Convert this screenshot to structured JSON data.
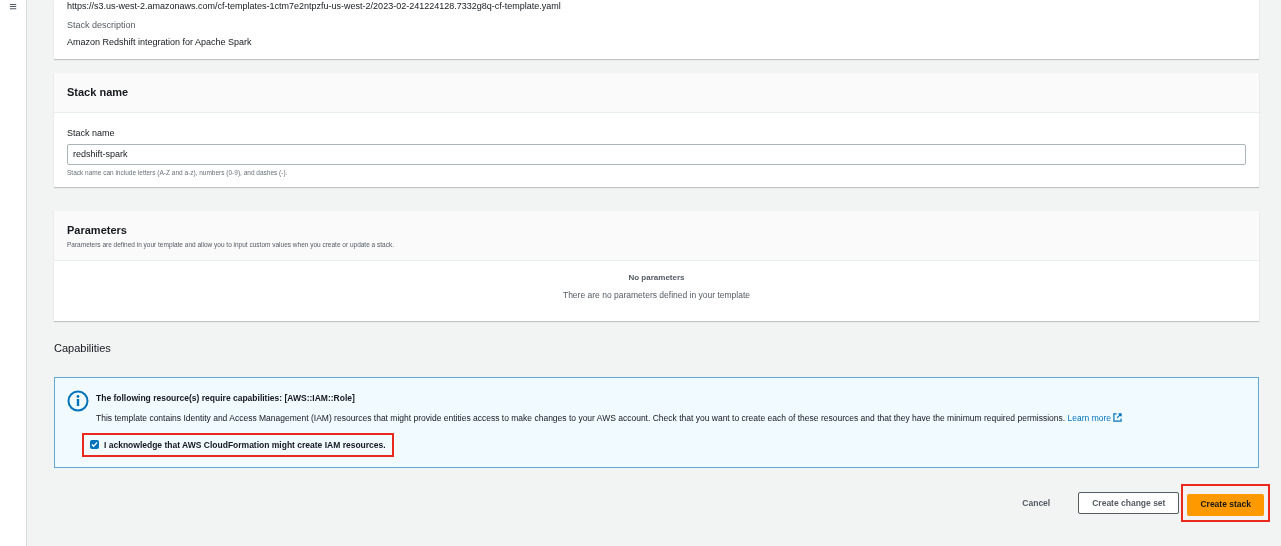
{
  "menu_icon": "≡",
  "template_card": {
    "url": "https://s3.us-west-2.amazonaws.com/cf-templates-1ctm7e2ntpzfu-us-west-2/2023-02-241224128.7332g8q-cf-template.yaml",
    "description_label": "Stack description",
    "description": "Amazon Redshift integration for Apache Spark"
  },
  "stack_name_card": {
    "title": "Stack name",
    "field_label": "Stack name",
    "value": "redshift-spark",
    "hint": "Stack name can include letters (A-Z and a-z), numbers (0-9), and dashes (-)."
  },
  "parameters_card": {
    "title": "Parameters",
    "subtitle": "Parameters are defined in your template and allow you to input custom values when you create or update a stack.",
    "empty_title": "No parameters",
    "empty_text": "There are no parameters defined in your template"
  },
  "capabilities": {
    "title": "Capabilities",
    "alert_title": "The following resource(s) require capabilities: [AWS::IAM::Role]",
    "alert_text": "This template contains Identity and Access Management (IAM) resources that might provide entities access to make changes to your AWS account. Check that you want to create each of these resources and that they have the minimum required permissions.",
    "link": "Learn more",
    "acknowledge": {
      "label": "I acknowledge that AWS CloudFormation might create IAM resources.",
      "checked": true,
      "highlighted": true
    }
  },
  "buttons": [
    {
      "label": "Cancel",
      "kind": "link",
      "highlighted": false
    },
    {
      "label": "Create change set",
      "kind": "normal",
      "highlighted": false
    },
    {
      "label": "Create stack",
      "kind": "primary",
      "highlighted": true
    }
  ]
}
